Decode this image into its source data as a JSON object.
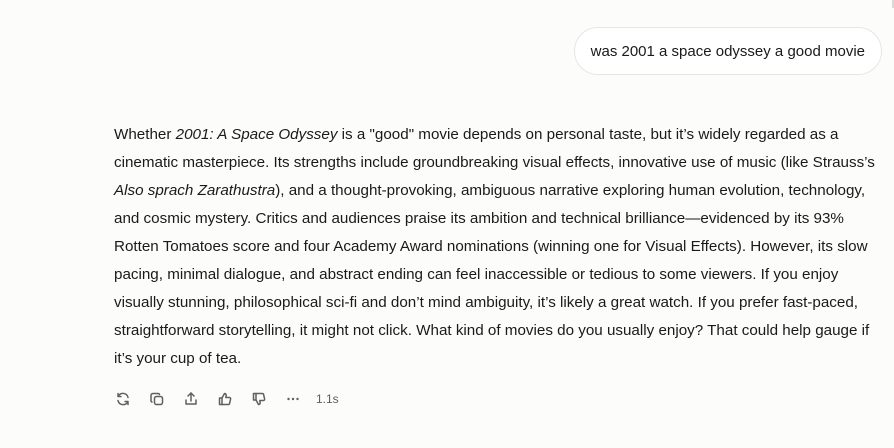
{
  "user_message": "was 2001 a space odyssey a good movie",
  "assistant_reply": {
    "segments": [
      {
        "text": "Whether ",
        "italic": false
      },
      {
        "text": "2001: A Space Odyssey",
        "italic": true
      },
      {
        "text": " is a \"good\" movie depends on personal taste, but it’s widely regarded as a cinematic masterpiece. Its strengths include groundbreaking visual effects, innovative use of music (like Strauss’s ",
        "italic": false
      },
      {
        "text": "Also sprach Zarathustra",
        "italic": true
      },
      {
        "text": "), and a thought-provoking, ambiguous narrative exploring human evolution, technology, and cosmic mystery. Critics and audiences praise its ambition and technical brilliance—evidenced by its 93% Rotten Tomatoes score and four Academy Award nominations (winning one for Visual Effects). However, its slow pacing, minimal dialogue, and abstract ending can feel inaccessible or tedious to some viewers. If you enjoy visually stunning, philosophical sci-fi and don’t mind ambiguity, it’s likely a great watch. If you prefer fast-paced, straightforward storytelling, it might not click. What kind of movies do you usually enjoy? That could help gauge if it’s your cup of tea.",
        "italic": false
      }
    ]
  },
  "actions": {
    "icons": [
      "regenerate-icon",
      "copy-icon",
      "share-icon",
      "thumbs-up-icon",
      "thumbs-down-icon",
      "more-icon"
    ],
    "duration": "1.1s"
  },
  "colors": {
    "background": "#fcfcfb",
    "bubble_border": "#e6e6e4",
    "text": "#1a1a1a",
    "icon": "#5f5f5c"
  }
}
